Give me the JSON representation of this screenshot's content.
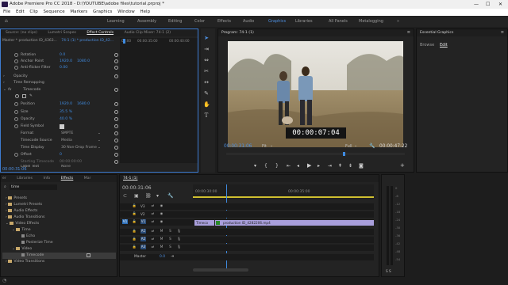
{
  "window": {
    "title": "Adobe Premiere Pro CC 2018 - D:\\YOUTUBE\\adobe files\\tutorial.prproj *",
    "minimize": "—",
    "maximize": "☐",
    "close": "✕"
  },
  "menu": [
    "File",
    "Edit",
    "Clip",
    "Sequence",
    "Markers",
    "Graphics",
    "Window",
    "Help"
  ],
  "workspaces": {
    "items": [
      "Learning",
      "Assembly",
      "Editing",
      "Color",
      "Effects",
      "Audio",
      "Graphics",
      "Libraries",
      "All Panels",
      "Metalogging"
    ],
    "active": "Graphics",
    "more": "»"
  },
  "source_panel": {
    "tabs": [
      "Source: (no clips)",
      "Lumetri Scopes",
      "Effect Controls",
      "Audio Clip Mixer: 74-1 (2)"
    ],
    "clip_path": "Master * production ID_4363...",
    "clip_active": "74-1 (1) * production ID_42...",
    "ruler": [
      "00:00",
      "00:00:35:00",
      "00:00:40:00"
    ],
    "rows": [
      {
        "label": "Rotation",
        "value": "0.0"
      },
      {
        "label": "Anchor Point",
        "value": "1920.0",
        "value2": "1080.0"
      },
      {
        "label": "Anti-flicker Filter",
        "value": "0.00"
      },
      {
        "label": "Opacity",
        "value": ""
      },
      {
        "label": "Time Remapping",
        "value": ""
      },
      {
        "label": "Timecode",
        "value": ""
      },
      {
        "label": "Position",
        "value": "1920.0",
        "value2": "1680.0"
      },
      {
        "label": "Size",
        "value": "35.5 %"
      },
      {
        "label": "Opacity",
        "value": "40.0 %"
      },
      {
        "label": "Field Symbol",
        "value": ""
      },
      {
        "label": "Format",
        "value": "SMPTE"
      },
      {
        "label": "Timecode Source",
        "value": "Media"
      },
      {
        "label": "Time Display",
        "value": "30 Non-Drop Frame"
      },
      {
        "label": "Offset",
        "value": "0"
      },
      {
        "label": "Starting Timecode",
        "value": "00:00:00:00"
      },
      {
        "label": "Label Text",
        "value": "None"
      }
    ],
    "timecode": "00:00:31:06"
  },
  "program": {
    "title": "Program: 74-1 (1)",
    "overlay_timecode": "00:00:07:04",
    "current": "00:00:31:06",
    "fit": "Fit",
    "quality": "Full",
    "duration": "00:00:47:22"
  },
  "essential_graphics": {
    "title": "Essential Graphics",
    "tabs": [
      "Browse",
      "Edit"
    ]
  },
  "project_panel": {
    "tabs": [
      "er",
      "Libraries",
      "Info",
      "Effects",
      "Mar"
    ],
    "search": "time",
    "items": [
      {
        "label": "Presets",
        "indent": 1
      },
      {
        "label": "Lumetri Presets",
        "indent": 1
      },
      {
        "label": "Audio Effects",
        "indent": 1
      },
      {
        "label": "Audio Transitions",
        "indent": 1
      },
      {
        "label": "Video Effects",
        "indent": 1
      },
      {
        "label": "Time",
        "indent": 2
      },
      {
        "label": "Echo",
        "indent": 3
      },
      {
        "label": "Posterize Time",
        "indent": 3
      },
      {
        "label": "Video",
        "indent": 2
      },
      {
        "label": "Timecode",
        "indent": 3
      },
      {
        "label": "Video Transitions",
        "indent": 1
      }
    ]
  },
  "timeline": {
    "title": "74-1 (1)",
    "timecode": "00:00:31:06",
    "ruler": [
      "00:00:30:00",
      "00:00:35:00"
    ],
    "tracks": [
      "V3",
      "V2",
      "V1",
      "A1",
      "A2",
      "A3",
      "Master"
    ],
    "master_value": "0.0",
    "clips": [
      {
        "label": "Timeco"
      },
      {
        "label": "production ID_4282206.mp4"
      }
    ]
  },
  "audio_meter": {
    "labels": [
      "0",
      "-6",
      "-12",
      "-18",
      "-24",
      "-30",
      "-36",
      "-42",
      "-48",
      "-54"
    ],
    "footer": "S  S"
  }
}
